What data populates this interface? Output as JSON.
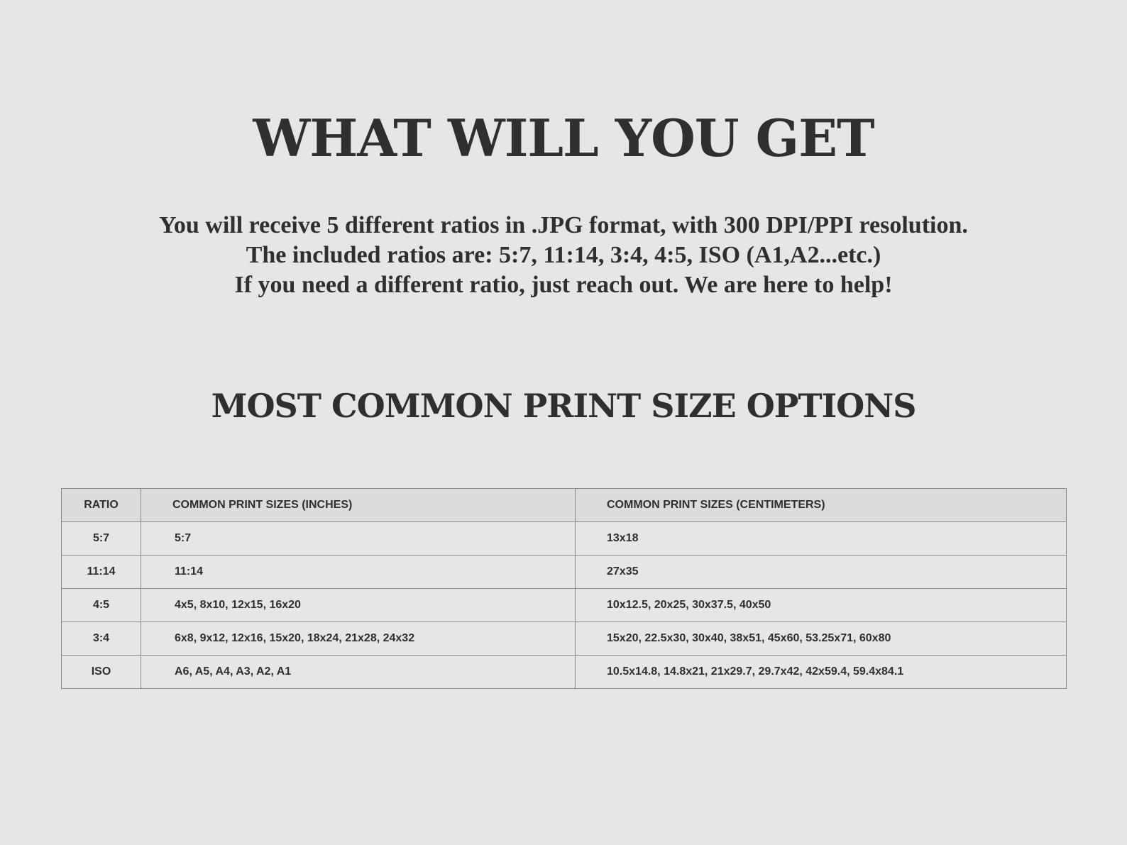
{
  "heading": "WHAT WILL YOU GET",
  "intro": {
    "line1": "You will receive 5 different ratios in .JPG format, with 300 DPI/PPI resolution.",
    "line2": "The included ratios are: 5:7, 11:14, 3:4, 4:5, ISO (A1,A2...etc.)",
    "line3": "If you need a different ratio, just reach out. We are here to help!"
  },
  "section_heading": "MOST COMMON PRINT SIZE OPTIONS",
  "table": {
    "headers": {
      "ratio": "RATIO",
      "inches": "COMMON PRINT SIZES (INCHES)",
      "centimeters": "COMMON PRINT SIZES (CENTIMETERS)"
    },
    "rows": [
      {
        "ratio": "5:7",
        "inches": "5:7",
        "centimeters": "13x18"
      },
      {
        "ratio": "11:14",
        "inches": "11:14",
        "centimeters": "27x35"
      },
      {
        "ratio": "4:5",
        "inches": "4x5, 8x10, 12x15, 16x20",
        "centimeters": "10x12.5, 20x25, 30x37.5, 40x50"
      },
      {
        "ratio": "3:4",
        "inches": "6x8, 9x12, 12x16, 15x20, 18x24, 21x28, 24x32",
        "centimeters": "15x20, 22.5x30, 30x40, 38x51, 45x60, 53.25x71, 60x80"
      },
      {
        "ratio": "ISO",
        "inches": "A6, A5, A4, A3, A2, A1",
        "centimeters": "10.5x14.8, 14.8x21, 21x29.7, 29.7x42, 42x59.4, 59.4x84.1"
      }
    ]
  },
  "colors": {
    "background": "#e6e6e6",
    "text": "#2f2f2e",
    "header_row": "#dcdcdc",
    "border": "#8a8a8a"
  }
}
